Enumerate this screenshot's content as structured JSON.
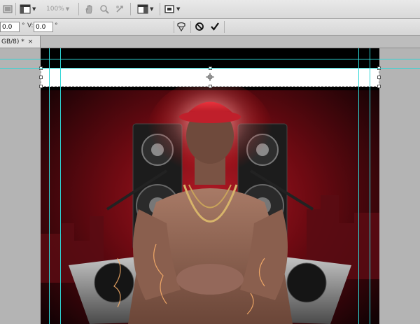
{
  "toolbar": {
    "zoom_value": "100%",
    "items": [
      "launch-bridge",
      "arrange-documents",
      "zoom-level",
      "hand-tool",
      "zoom-tool",
      "rotate-view",
      "screen-layout",
      "screen-mode"
    ]
  },
  "options_bar": {
    "h_field_value": "0.0",
    "h_unit": "°",
    "v_label": "V:",
    "v_field_value": "0.0",
    "v_unit": "°"
  },
  "document_tab": {
    "title": "GB/8) *",
    "close_glyph": "×"
  },
  "colors": {
    "guide": "#2fd6d6",
    "canvas_bg": "#b4b4b4",
    "cap_red": "#d42a35",
    "background_red": "#6e0a12"
  },
  "icons": [
    "bridge-icon",
    "arrange-icon",
    "hand-icon",
    "zoom-icon",
    "rotate-view-icon",
    "screen-mode-icon",
    "warp-icon",
    "cancel-icon",
    "commit-icon"
  ]
}
